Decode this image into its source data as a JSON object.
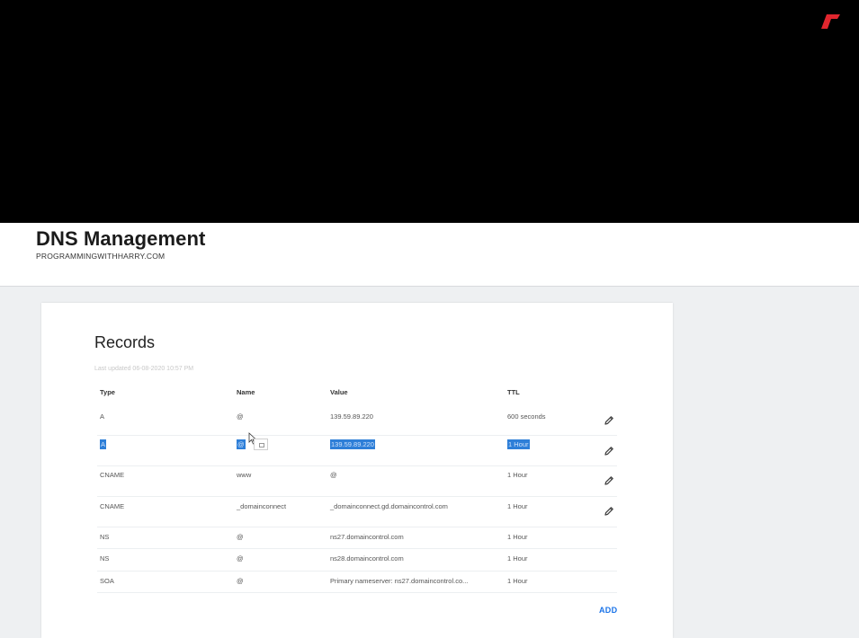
{
  "header": {
    "title": "DNS Management",
    "domain": "PROGRAMMINGWITHHARRY.COM"
  },
  "records": {
    "title": "Records",
    "last_updated": "Last updated 06-08-2020 10:57 PM",
    "columns": {
      "type": "Type",
      "name": "Name",
      "value": "Value",
      "ttl": "TTL"
    },
    "rows": [
      {
        "type": "A",
        "name": "@",
        "value": "139.59.89.220",
        "ttl": "600 seconds",
        "editable": true,
        "selected": false
      },
      {
        "type": "A",
        "name": "@",
        "value": "139.59.89.220",
        "ttl": "1 Hour",
        "editable": true,
        "selected": true
      },
      {
        "type": "CNAME",
        "name": "www",
        "value": "@",
        "ttl": "1 Hour",
        "editable": true,
        "selected": false
      },
      {
        "type": "CNAME",
        "name": "_domainconnect",
        "value": "_domainconnect.gd.domaincontrol.com",
        "ttl": "1 Hour",
        "editable": true,
        "selected": false
      },
      {
        "type": "NS",
        "name": "@",
        "value": "ns27.domaincontrol.com",
        "ttl": "1 Hour",
        "editable": false,
        "selected": false
      },
      {
        "type": "NS",
        "name": "@",
        "value": "ns28.domaincontrol.com",
        "ttl": "1 Hour",
        "editable": false,
        "selected": false
      },
      {
        "type": "SOA",
        "name": "@",
        "value": "Primary nameserver: ns27.domaincontrol.co...",
        "ttl": "1 Hour",
        "editable": false,
        "selected": false
      }
    ],
    "add_label": "ADD"
  },
  "icons": {
    "logo": "brand-logo-icon",
    "edit": "pencil-icon",
    "cursor": "mouse-cursor-icon"
  },
  "colors": {
    "accent": "#1a73e8",
    "selection": "#2e7fd8",
    "logo": "#e0262e"
  }
}
